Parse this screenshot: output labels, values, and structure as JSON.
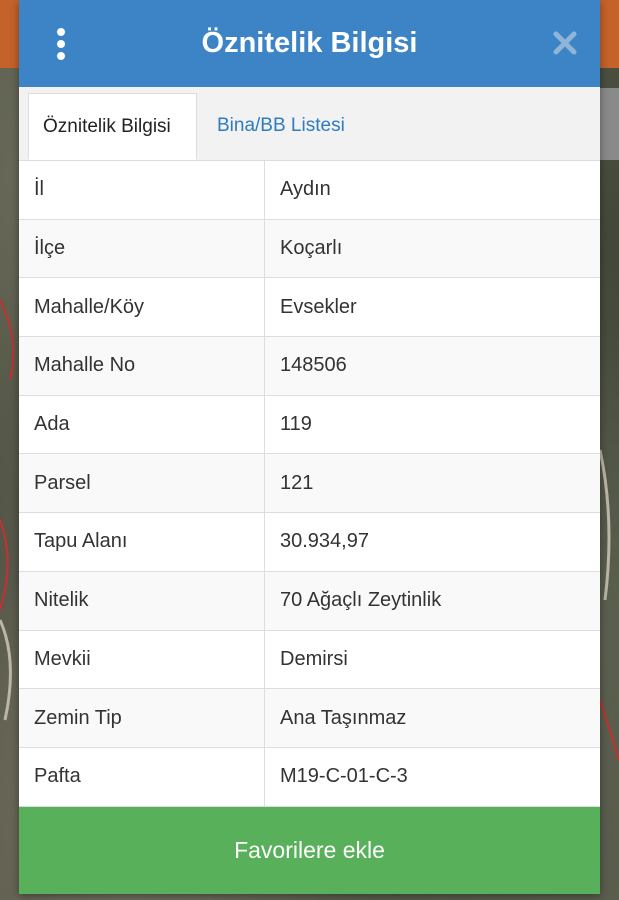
{
  "dialog": {
    "title": "Öznitelik Bilgisi",
    "menu_icon": "vertical-dots-icon",
    "close_icon": "close-icon"
  },
  "tabs": [
    {
      "label": "Öznitelik Bilgisi",
      "active": true
    },
    {
      "label": "Bina/BB Listesi",
      "active": false
    }
  ],
  "attributes": [
    {
      "key": "İl",
      "value": "Aydın"
    },
    {
      "key": "İlçe",
      "value": "Koçarlı"
    },
    {
      "key": "Mahalle/Köy",
      "value": "Evsekler"
    },
    {
      "key": "Mahalle No",
      "value": "148506"
    },
    {
      "key": "Ada",
      "value": "119"
    },
    {
      "key": "Parsel",
      "value": "121"
    },
    {
      "key": "Tapu Alanı",
      "value": "30.934,97"
    },
    {
      "key": "Nitelik",
      "value": "70 Ağaçlı Zeytinlik"
    },
    {
      "key": "Mevkii",
      "value": "Demirsi"
    },
    {
      "key": "Zemin Tip",
      "value": "Ana Taşınmaz"
    },
    {
      "key": "Pafta",
      "value": "M19-C-01-C-3"
    }
  ],
  "footer": {
    "favorite_label": "Favorilere ekle"
  },
  "colors": {
    "header": "#3d84c6",
    "tab_link": "#2f7bbf",
    "button": "#58b05a",
    "map_accent": "#c4622a"
  }
}
